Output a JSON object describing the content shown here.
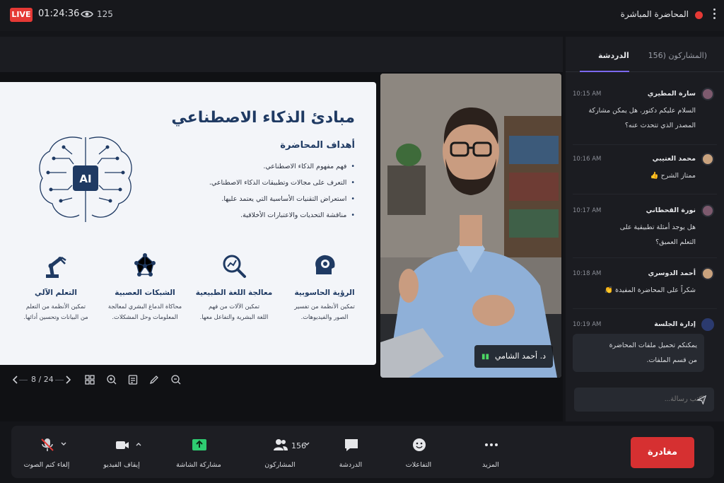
{
  "topbar": {
    "live_label": "LIVE",
    "timer": "01:24:36",
    "viewers": "125",
    "title": "المحاضرة المباشرة"
  },
  "slide": {
    "title": "مبادئ الذكاء الاصطناعي",
    "subtitle": "أهداف المحاضرة",
    "bullets": [
      "فهم مفهوم الذكاء الاصطناعي.",
      "التعرف على مجالات وتطبيقات الذكاء الاصطناعي.",
      "استعراض التقنيات الأساسية التي يعتمد عليها.",
      "مناقشة التحديات والاعتبارات الأخلاقية."
    ],
    "ai_label": "AI",
    "features": [
      {
        "title": "الرؤية الحاسوبية",
        "line1": "تمكين الأنظمة من تفسير",
        "line2": "الصور والفيديوهات.",
        "icon": "vision-head-icon"
      },
      {
        "title": "معالجة اللغة الطبيعية",
        "line1": "تمكين الآلات من فهم",
        "line2": "اللغة البشرية والتفاعل معها.",
        "icon": "magnifier-chart-icon"
      },
      {
        "title": "الشبكات العصبية",
        "line1": "محاكاة الدماغ البشري لمعالجة",
        "line2": "المعلومات وحل المشكلات.",
        "icon": "network-icon"
      },
      {
        "title": "التعلم الآلي",
        "line1": "تمكين الأنظمة من التعلم",
        "line2": "من البيانات وتحسين أدائها.",
        "icon": "robot-arm-icon"
      }
    ]
  },
  "slidenav": {
    "page": "8 / 24"
  },
  "speaker": {
    "name": "د. أحمد الشامي"
  },
  "chat": {
    "tab_chat": "الدردشة",
    "tab_participants": "(المشاركون (156",
    "messages": [
      {
        "name": "سارة المطيري",
        "time": "10:15 AM",
        "line1": "السلام عليكم دكتور. هل يمكن مشاركة",
        "line2": "المصدر الذي تتحدث عنه؟"
      },
      {
        "name": "محمد العتيبي",
        "time": "10:16 AM",
        "line1": "ممتاز الشرح 👍",
        "line2": ""
      },
      {
        "name": "نورة القحطاني",
        "time": "10:17 AM",
        "line1": "هل يوجد أمثلة تطبيقية على",
        "line2": "التعلم العميق؟"
      },
      {
        "name": "أحمد الدوسري",
        "time": "10:18 AM",
        "line1": "شكراً على المحاضرة المفيدة 👏",
        "line2": ""
      },
      {
        "name": "إدارة الجلسة",
        "time": "10:19 AM",
        "line1": "يمكنكم تحميل ملفات المحاضرة",
        "line2": "من قسم الملفات."
      }
    ],
    "input_placeholder": "اكتب رسالة..."
  },
  "controls": {
    "mute": "إلغاء كتم الصوت",
    "video": "إيقاف الفيديو",
    "share": "مشاركة الشاشة",
    "participants": "المشاركون",
    "participants_count": "156",
    "chat": "الدردشة",
    "reactions": "التفاعلات",
    "more": "المزيد",
    "leave": "مغادرة"
  },
  "colors": {
    "live": "#e53935",
    "accent": "#7b68ee",
    "leave": "#d63031",
    "share": "#2ecc71",
    "slide_navy": "#1f3a63"
  }
}
